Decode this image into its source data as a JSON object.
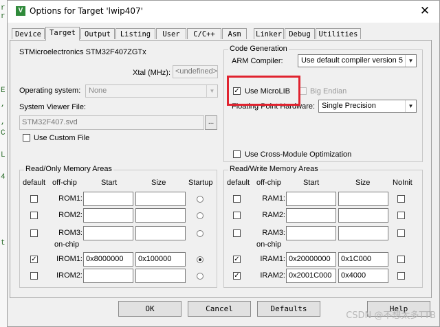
{
  "edge_code": [
    "r",
    "r",
    "E",
    ",",
    ",",
    "C",
    "L",
    "4",
    "t"
  ],
  "window": {
    "title": "Options for Target 'lwip407'",
    "icon_letter": "V",
    "close_glyph": "✕"
  },
  "tabs": [
    "Device",
    "Target",
    "Output",
    "Listing",
    "User",
    "C/C++",
    "Asm",
    "Linker",
    "Debug",
    "Utilities"
  ],
  "device_name": "STMicroelectronics STM32F407ZGTx",
  "xtal": {
    "label": "Xtal (MHz):",
    "value": "<undefined>"
  },
  "os": {
    "label": "Operating system:",
    "value": "None"
  },
  "viewer": {
    "label": "System Viewer File:",
    "value": "STM32F407.svd",
    "browse": "...",
    "custom_label": "Use Custom File"
  },
  "codegen": {
    "title": "Code Generation",
    "compiler_label": "ARM Compiler:",
    "compiler_value": "Use default compiler version 5",
    "microlib_label": "Use MicroLIB",
    "microlib_checked": true,
    "bigendian_label": "Big Endian",
    "fp_label": "Floating Point Hardware:",
    "fp_value": "Single Precision",
    "crossmod_label": "Use Cross-Module Optimization"
  },
  "ro": {
    "title": "Read/Only Memory Areas",
    "headers": {
      "default": "default",
      "offchip": "off-chip",
      "start": "Start",
      "size": "Size",
      "extra": "Startup"
    },
    "onchip_label": "on-chip",
    "rows": [
      {
        "name": "ROM1:",
        "start": "",
        "size": "",
        "checked": false,
        "selected": false
      },
      {
        "name": "ROM2:",
        "start": "",
        "size": "",
        "checked": false,
        "selected": false
      },
      {
        "name": "ROM3:",
        "start": "",
        "size": "",
        "checked": false,
        "selected": false
      },
      {
        "name": "IROM1:",
        "start": "0x8000000",
        "size": "0x100000",
        "checked": true,
        "selected": true
      },
      {
        "name": "IROM2:",
        "start": "",
        "size": "",
        "checked": false,
        "selected": false
      }
    ]
  },
  "rw": {
    "title": "Read/Write Memory Areas",
    "headers": {
      "default": "default",
      "offchip": "off-chip",
      "start": "Start",
      "size": "Size",
      "extra": "NoInit"
    },
    "onchip_label": "on-chip",
    "rows": [
      {
        "name": "RAM1:",
        "start": "",
        "size": "",
        "checked": false
      },
      {
        "name": "RAM2:",
        "start": "",
        "size": "",
        "checked": false
      },
      {
        "name": "RAM3:",
        "start": "",
        "size": "",
        "checked": false
      },
      {
        "name": "IRAM1:",
        "start": "0x20000000",
        "size": "0x1C000",
        "checked": true
      },
      {
        "name": "IRAM2:",
        "start": "0x2001C000",
        "size": "0x4000",
        "checked": true
      }
    ]
  },
  "buttons": {
    "ok": "OK",
    "cancel": "Cancel",
    "defaults": "Defaults",
    "help": "Help"
  },
  "watermark": "CSDN @不想太多TTB",
  "highlight_color": "#e0232f"
}
